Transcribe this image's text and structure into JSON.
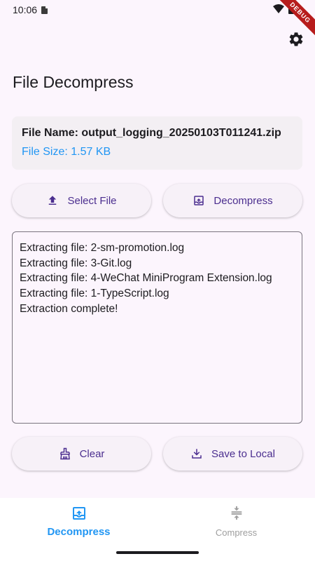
{
  "status": {
    "time": "10:06",
    "debug_label": "DEBUG"
  },
  "header": {
    "title": "File Decompress"
  },
  "file_info": {
    "name_label": "File Name: ",
    "name_value": "output_logging_20250103T011241.zip",
    "size_text": "File Size: 1.57 KB"
  },
  "actions": {
    "select_label": "Select File",
    "decompress_label": "Decompress",
    "clear_label": "Clear",
    "save_label": "Save to Local"
  },
  "log": {
    "lines": [
      "Extracting file: 2-sm-promotion.log",
      "Extracting file: 3-Git.log",
      "Extracting file: 4-WeChat MiniProgram Extension.log",
      "Extracting file: 1-TypeScript.log",
      "Extraction complete!"
    ]
  },
  "nav": {
    "items": [
      {
        "label": "Decompress",
        "active": true
      },
      {
        "label": "Compress",
        "active": false
      }
    ]
  },
  "colors": {
    "accent": "#2196f3",
    "button_text": "#4b2e8f",
    "background": "#fcf5fd"
  }
}
